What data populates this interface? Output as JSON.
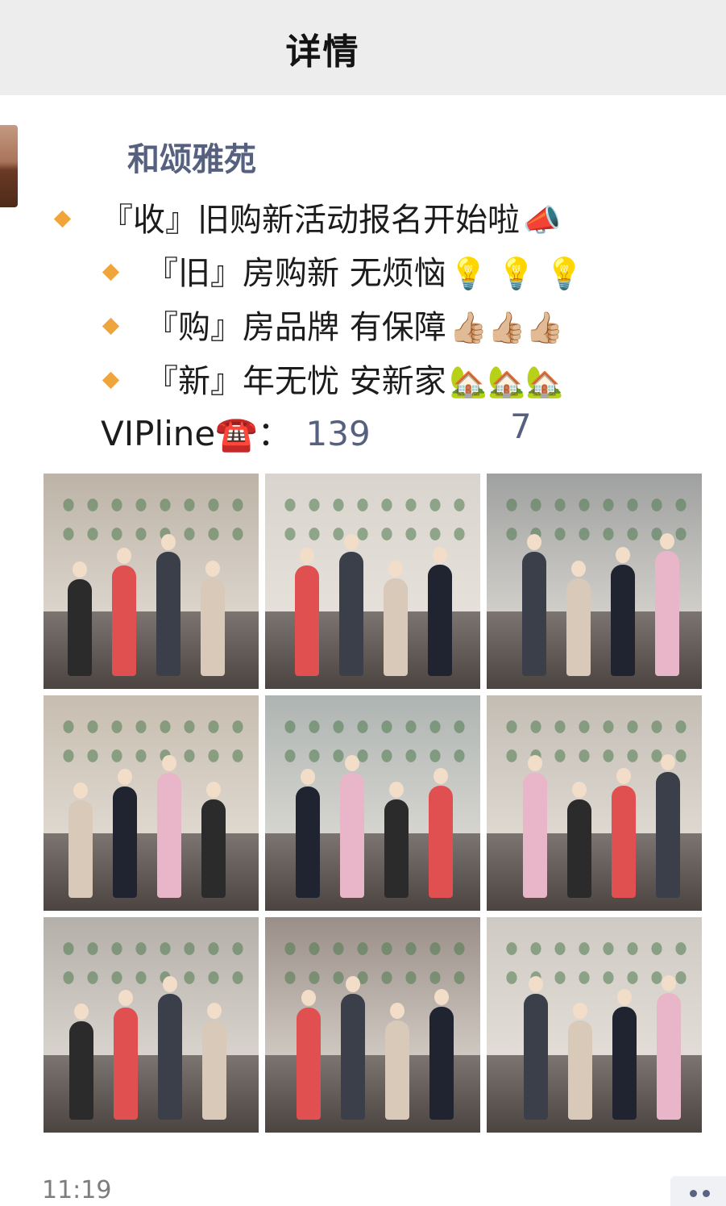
{
  "header": {
    "title": "详情"
  },
  "post": {
    "author": "和颂雅苑",
    "headline": {
      "text": "『收』旧购新活动报名开始啦",
      "emoji": "📣"
    },
    "items": [
      {
        "text": "『旧』房购新 无烦恼",
        "emoji": "💡 💡 💡"
      },
      {
        "text": "『购』房品牌 有保障",
        "emoji": "👍🏼👍🏼👍🏼"
      },
      {
        "text": "『新』年无忧 安新家",
        "emoji": "🏡🏡🏡"
      }
    ],
    "vip_label": "VIPline☎️：",
    "vip_phone_start": "139",
    "vip_phone_end": "7",
    "timestamp": "11:19"
  },
  "photos": [
    {
      "name": "photo-1",
      "theme": "#bdb3a7"
    },
    {
      "name": "photo-2",
      "theme": "#d9d4cd"
    },
    {
      "name": "photo-3",
      "theme": "#9fa1a0"
    },
    {
      "name": "photo-4",
      "theme": "#c7bdb0"
    },
    {
      "name": "photo-5",
      "theme": "#aeb4b2"
    },
    {
      "name": "photo-6",
      "theme": "#c3bdb4"
    },
    {
      "name": "photo-7",
      "theme": "#b5afa9"
    },
    {
      "name": "photo-8",
      "theme": "#9a8f88"
    },
    {
      "name": "photo-9",
      "theme": "#cfcac3"
    }
  ],
  "colors": {
    "bullet": "#f0a43c",
    "link": "#56607f",
    "nav_bg": "#ededed"
  },
  "icons": [
    "megaphone-icon",
    "lightbulb-icon",
    "thumbs-up-icon",
    "house-icon",
    "telephone-icon",
    "more-icon"
  ]
}
